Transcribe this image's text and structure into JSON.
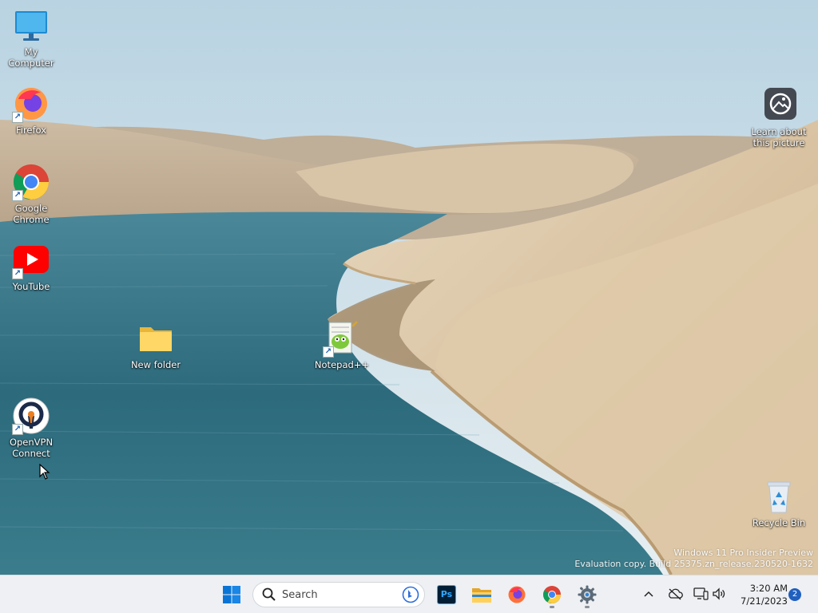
{
  "desktop": {
    "icons": [
      {
        "id": "my-computer",
        "label": "My Computer",
        "icon": "monitor-icon"
      },
      {
        "id": "firefox",
        "label": "Firefox",
        "icon": "firefox-icon",
        "shortcut": true
      },
      {
        "id": "google-chrome",
        "label": "Google Chrome",
        "icon": "chrome-icon",
        "shortcut": true
      },
      {
        "id": "youtube",
        "label": "YouTube",
        "icon": "youtube-icon",
        "shortcut": true
      },
      {
        "id": "new-folder",
        "label": "New folder",
        "icon": "folder-icon"
      },
      {
        "id": "notepadpp",
        "label": "Notepad++",
        "icon": "notepadpp-icon",
        "shortcut": true
      },
      {
        "id": "openvpn",
        "label": "OpenVPN Connect",
        "icon": "openvpn-icon",
        "shortcut": true
      },
      {
        "id": "learn-picture",
        "label": "Learn about this picture",
        "icon": "picture-info-icon"
      },
      {
        "id": "recycle-bin",
        "label": "Recycle Bin",
        "icon": "recycle-bin-icon"
      }
    ],
    "shortcut_arrow": "↗"
  },
  "watermark": {
    "line1": "Windows 11 Pro Insider Preview",
    "line2": "Evaluation copy. Build 25375.zn_release.230520-1632"
  },
  "taskbar": {
    "start": {
      "icon": "windows-start-icon"
    },
    "search": {
      "placeholder": "Search",
      "icon": "search-icon",
      "bing_icon": "bing-icon"
    },
    "pinned": [
      {
        "id": "photoshop",
        "icon": "photoshop-icon",
        "text": "Ps",
        "running": false
      },
      {
        "id": "file-explorer",
        "icon": "file-explorer-icon",
        "running": false
      },
      {
        "id": "firefox",
        "icon": "firefox-icon",
        "running": false
      },
      {
        "id": "chrome",
        "icon": "chrome-icon",
        "running": true
      },
      {
        "id": "settings",
        "icon": "settings-gear-icon",
        "running": true
      }
    ],
    "tray": {
      "icons": [
        "chevron-up-icon",
        "onedrive-offline-icon",
        "network-icon",
        "volume-icon"
      ],
      "time": "3:20 AM",
      "date": "7/21/2023",
      "notification_count": "2"
    }
  },
  "colors": {
    "taskbar_bg": "#eef0f3",
    "accent": "#1f5fbf",
    "sky": "#cfe0ea",
    "water": "#2e6d80",
    "sand": "#d9c3a3"
  }
}
